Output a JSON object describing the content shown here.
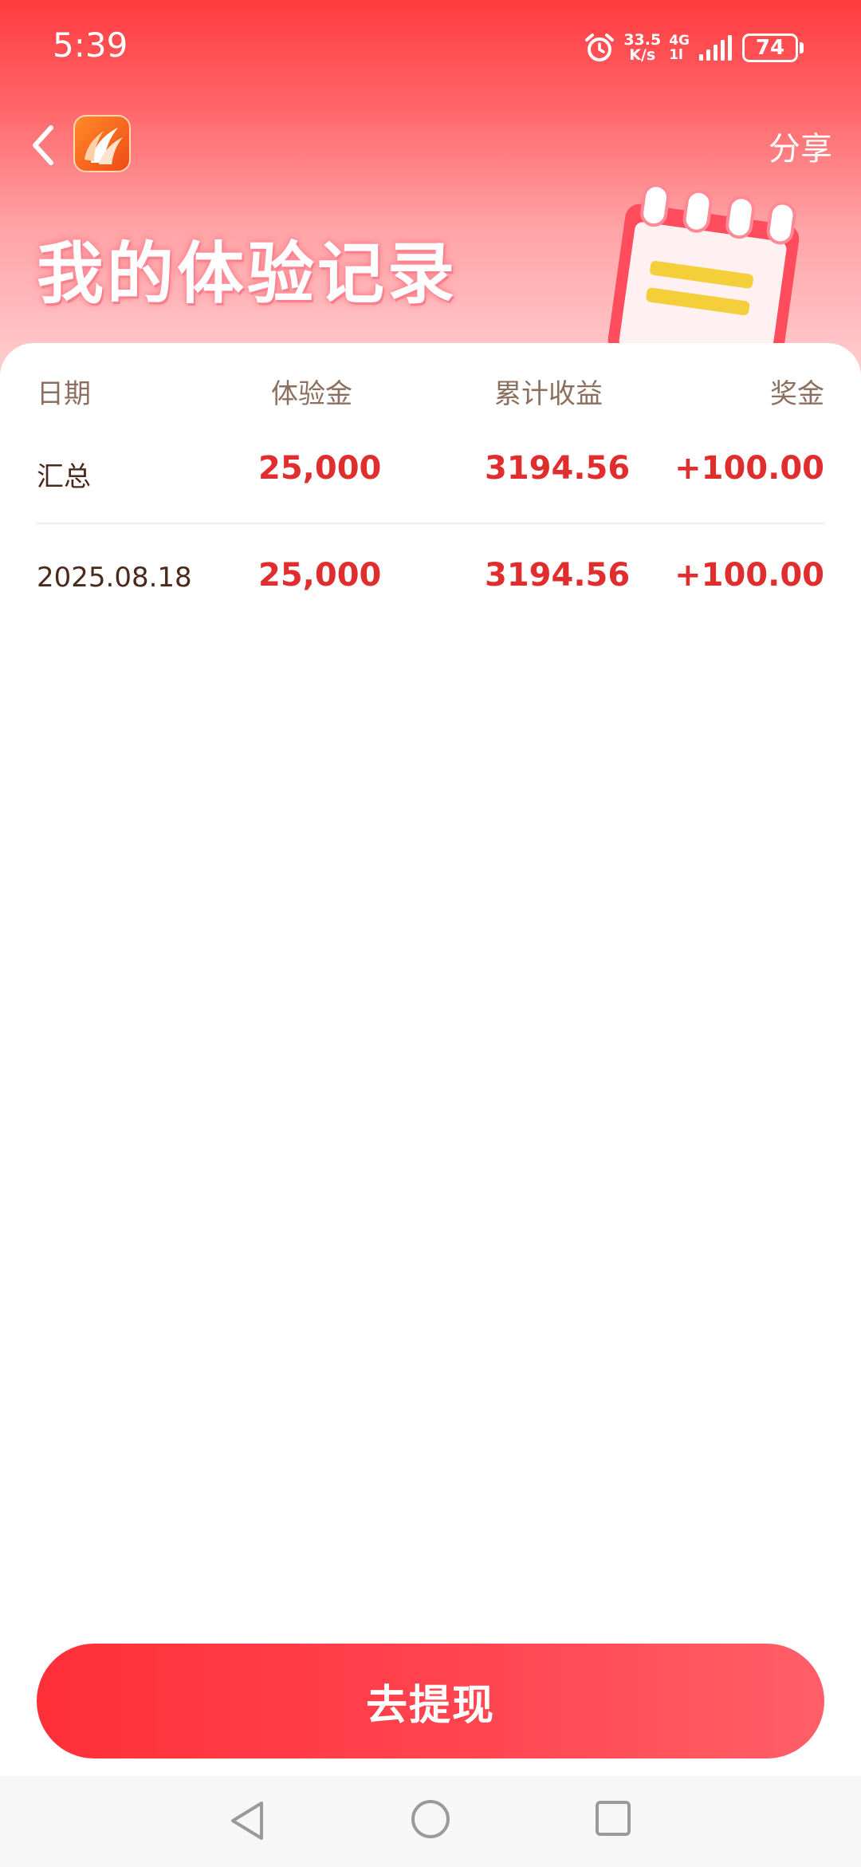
{
  "status_bar": {
    "time": "5:39",
    "net_speed_value": "33.5",
    "net_speed_unit": "K/s",
    "network_type": "4G",
    "network_sub": "1l",
    "battery": "74",
    "icons": [
      "alarm-icon",
      "signal-icon",
      "battery-icon"
    ]
  },
  "nav": {
    "back_icon": "chevron-left-icon",
    "logo_icon": "app-logo-icon",
    "share_label": "分享"
  },
  "header": {
    "title": "我的体验记录",
    "illustration": "notebook-illustration"
  },
  "table": {
    "columns": [
      "日期",
      "体验金",
      "累计收益",
      "奖金"
    ],
    "rows": [
      {
        "date": "汇总",
        "fund": "25,000",
        "earnings": "3194.56",
        "bonus": "+100.00"
      },
      {
        "date": "2025.08.18",
        "fund": "25,000",
        "earnings": "3194.56",
        "bonus": "+100.00"
      }
    ]
  },
  "actions": {
    "withdraw_label": "去提现"
  },
  "colors": {
    "brand_red": "#ff2f38",
    "value_red": "#e02e2e",
    "header_text": "#8c6f5e"
  }
}
